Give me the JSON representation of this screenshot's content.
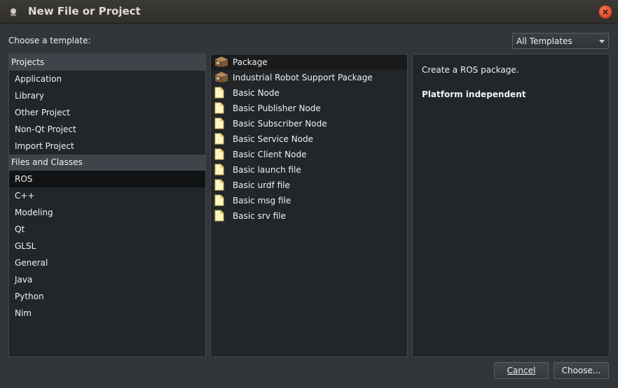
{
  "window": {
    "title": "New File or Project"
  },
  "header": {
    "choose_label": "Choose a template:",
    "filter_value": "All Templates"
  },
  "categories": [
    {
      "type": "header",
      "label": "Projects"
    },
    {
      "type": "item",
      "label": "Application"
    },
    {
      "type": "item",
      "label": "Library"
    },
    {
      "type": "item",
      "label": "Other Project"
    },
    {
      "type": "item",
      "label": "Non-Qt Project"
    },
    {
      "type": "item",
      "label": "Import Project"
    },
    {
      "type": "header",
      "label": "Files and Classes"
    },
    {
      "type": "item",
      "label": "ROS",
      "selected": true
    },
    {
      "type": "item",
      "label": "C++"
    },
    {
      "type": "item",
      "label": "Modeling"
    },
    {
      "type": "item",
      "label": "Qt"
    },
    {
      "type": "item",
      "label": "GLSL"
    },
    {
      "type": "item",
      "label": "General"
    },
    {
      "type": "item",
      "label": "Java"
    },
    {
      "type": "item",
      "label": "Python"
    },
    {
      "type": "item",
      "label": "Nim"
    }
  ],
  "templates": [
    {
      "label": "Package",
      "icon": "package-icon",
      "selected": true
    },
    {
      "label": "Industrial Robot Support Package",
      "icon": "package-icon"
    },
    {
      "label": "Basic Node",
      "icon": "file-icon"
    },
    {
      "label": "Basic Publisher Node",
      "icon": "file-icon"
    },
    {
      "label": "Basic Subscriber Node",
      "icon": "file-icon"
    },
    {
      "label": "Basic Service Node",
      "icon": "file-icon"
    },
    {
      "label": "Basic Client Node",
      "icon": "file-icon"
    },
    {
      "label": "Basic launch file",
      "icon": "file-icon"
    },
    {
      "label": "Basic urdf file",
      "icon": "file-icon"
    },
    {
      "label": "Basic msg file",
      "icon": "file-icon"
    },
    {
      "label": "Basic srv file",
      "icon": "file-icon"
    }
  ],
  "details": {
    "description": "Create a ROS package.",
    "platform": "Platform independent"
  },
  "buttons": {
    "cancel_label": "Cancel",
    "choose_label": "Choose..."
  },
  "colors": {
    "close_button": "#e05a33",
    "selection": "#111315"
  }
}
